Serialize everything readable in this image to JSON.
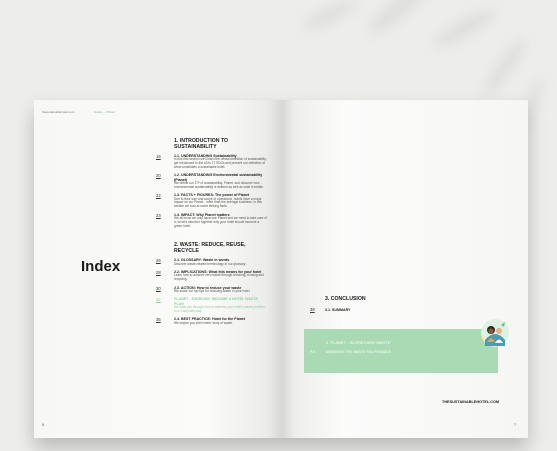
{
  "left_page": {
    "header_site": "thesustainablehotel.com",
    "header_tag": "Guide — Planet",
    "index_title": "Index",
    "page_number": "6"
  },
  "toc": {
    "section1": {
      "title": "1. INTRODUCTION TO SUSTAINABILITY",
      "entries": [
        {
          "page": "16",
          "title": "1.1. UNDERSTANDING Sustainability",
          "desc": "In this first section we'll learn the official definition of sustainability, get introduced to the UN's 17 SDGs and present our definition of what constitutes a sustainable hotel."
        },
        {
          "page": "20",
          "title": "1.2. UNDERSTANDING Environmental sustainability (Planet)",
          "desc": "We define our 3\"P of sustainability, Planet, and discover how environmental sustainability is defined as well as what it entails."
        },
        {
          "page": "22",
          "title": "1.3. FACTS + FIGURES: The power of Planet",
          "desc": "Due to their size and scope of operations, hotels have a major impact on our Planet - more than the average business. In this section we look at some striking facts."
        },
        {
          "page": "23",
          "title": "1.4. IMPACT: Why Planet matters",
          "desc": "We all know we only have one Planet and we need to take care of it, so let's discover together why your hotel should become a green hotel."
        }
      ]
    },
    "section2": {
      "title": "2. WASTE: REDUCE, REUSE, RECYCLE",
      "entries": [
        {
          "page": "26",
          "title": "2.1. GLOSSARY: Waste in words",
          "desc": "Discover waste-related terminology in our glossary."
        },
        {
          "page": "28",
          "title": "2.2. IMPLICATIONS: What this means for your hotel",
          "desc": "Learn how to achieve zero waste through reducing, reusing and recycling."
        },
        {
          "page": "30",
          "title": "2.3. ACTION: How to reduce your waste",
          "desc": "We share our top tips for reducing waste in your hotel."
        },
        {
          "page": "32",
          "title": "PLANET - EXERCISE: BECOME A HOTEL WASTE PLAN",
          "desc": "We walk you through how to address your hotel's waste problem in a 4-step/day way.",
          "green": true
        },
        {
          "page": "35",
          "title": "2.4. BEST PRACTICE: Hotel for the Planet",
          "desc": "We inspire you with hotels' story of waste."
        }
      ]
    }
  },
  "right_page": {
    "conclusion_title": "3. CONCLUSION",
    "summary_page": "38",
    "summary_label": "3.1. SUMMARY",
    "green_box": {
      "line1_num": "",
      "line1": "4. PLANET - SCORECARD WASTE",
      "line2_num": "P.4",
      "line2": "MANAGING THE WASTE YOU PRODUCE"
    },
    "site_footer": "THESUSTAINABLEHOTEL.COM",
    "page_number": "7"
  },
  "colors": {
    "accent_green": "#a9dab4",
    "text_dark": "#1b1b1b",
    "background": "#ededeb"
  }
}
